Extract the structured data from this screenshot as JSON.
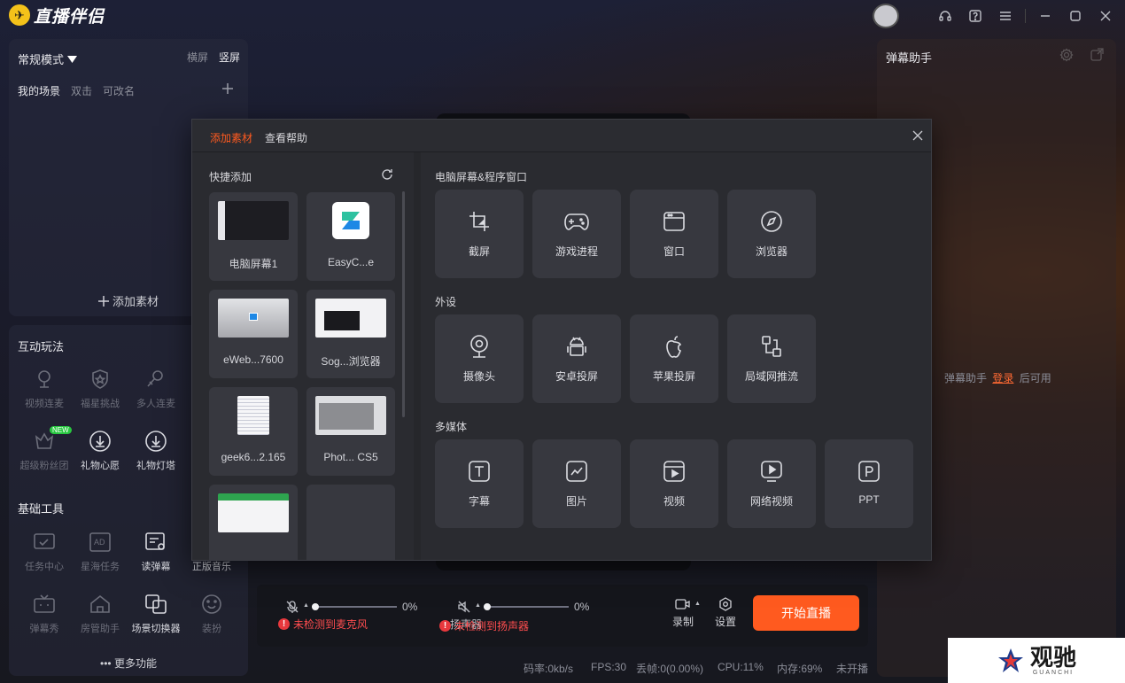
{
  "app": {
    "name": "直播伴侣"
  },
  "colors": {
    "accent": "#ff5a1f",
    "warn": "#ff4d4f",
    "link": "#ff6a33"
  },
  "left": {
    "mode": "常规模式",
    "orient_h": "横屏",
    "orient_v": "竖屏",
    "scene_title": "我的场景",
    "scene_hint1": "双击",
    "scene_hint2": "可改名",
    "add_source": "添加素材"
  },
  "interactive": {
    "title": "互动玩法",
    "items": [
      {
        "label": "视频连麦",
        "icon": "mic-icon"
      },
      {
        "label": "福星挑战",
        "icon": "shield-star-icon"
      },
      {
        "label": "多人连麦",
        "icon": "multi-mic-icon"
      },
      {
        "label": "超级粉丝团",
        "icon": "super-fan-icon",
        "badge": "NEW"
      },
      {
        "label": "礼物心愿",
        "icon": "download-circle-icon"
      },
      {
        "label": "礼物灯塔",
        "icon": "download-circle-icon"
      }
    ]
  },
  "basic": {
    "title": "基础工具",
    "items": [
      {
        "label": "任务中心",
        "icon": "task-icon"
      },
      {
        "label": "星海任务",
        "icon": "ad-icon"
      },
      {
        "label": "读弹幕",
        "icon": "read-barrage-icon"
      },
      {
        "label": "正版音乐",
        "icon": "music-icon"
      },
      {
        "label": "弹幕秀",
        "icon": "tv-icon"
      },
      {
        "label": "房管助手",
        "icon": "house-icon"
      },
      {
        "label": "场景切换器",
        "icon": "scene-switch-icon"
      },
      {
        "label": "装扮",
        "icon": "smile-icon"
      }
    ],
    "more": "更多功能"
  },
  "modal": {
    "tab_add": "添加素材",
    "tab_help": "查看帮助",
    "quick_title": "快捷添加",
    "quick_items": [
      {
        "label": "电脑屏幕1"
      },
      {
        "label": "EasyC...e"
      },
      {
        "label": "eWeb...7600"
      },
      {
        "label": "Sog...浏览器"
      },
      {
        "label": "geek6...2.165"
      },
      {
        "label": "Phot... CS5"
      },
      {
        "label": ""
      },
      {
        "label": ""
      }
    ],
    "sec1": "电脑屏幕&程序窗口",
    "sec1_items": [
      {
        "label": "截屏",
        "icon": "crop-icon"
      },
      {
        "label": "游戏进程",
        "icon": "gamepad-icon"
      },
      {
        "label": "窗口",
        "icon": "window-icon"
      },
      {
        "label": "浏览器",
        "icon": "compass-icon"
      }
    ],
    "sec2": "外设",
    "sec2_items": [
      {
        "label": "摄像头",
        "icon": "camera-icon"
      },
      {
        "label": "安卓投屏",
        "icon": "android-icon"
      },
      {
        "label": "苹果投屏",
        "icon": "apple-icon"
      },
      {
        "label": "局域网推流",
        "icon": "network-icon"
      }
    ],
    "sec3": "多媒体",
    "sec3_items": [
      {
        "label": "字幕",
        "icon": "text-icon"
      },
      {
        "label": "图片",
        "icon": "image-icon"
      },
      {
        "label": "视频",
        "icon": "video-icon"
      },
      {
        "label": "网络视频",
        "icon": "web-video-icon"
      },
      {
        "label": "PPT",
        "icon": "ppt-icon"
      }
    ]
  },
  "right": {
    "title": "弹幕助手",
    "hint_pre": "弹幕助手",
    "hint_link": "登录",
    "hint_post": "后可用"
  },
  "bottom": {
    "mic_pct": "0%",
    "speaker_pct": "0%",
    "mic_level": 0,
    "speaker_level": 0,
    "mic_warn": "未检测到麦克风",
    "speaker_label": "扬声器",
    "speaker_warn": "未检测到扬声器",
    "record": "录制",
    "settings": "设置",
    "start": "开始直播"
  },
  "status": {
    "bitrate": "码率:0kb/s",
    "fps": "FPS:30",
    "drop": "丢帧:0(0.00%)",
    "cpu": "CPU:11%",
    "mem": "内存:69%",
    "live": "未开播"
  },
  "watermark": {
    "text": "观驰",
    "sub": "GUANCHI"
  }
}
